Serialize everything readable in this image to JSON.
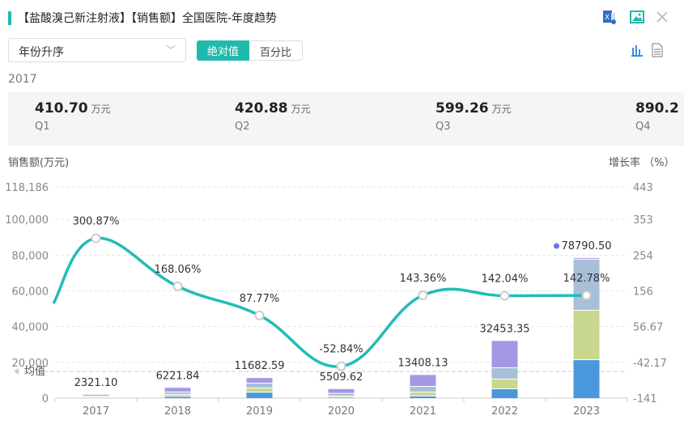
{
  "header": {
    "title": "【盐酸溴己新注射液】【销售额】全国医院-年度趋势",
    "icons": [
      "excel-export-icon",
      "image-export-icon",
      "close-icon"
    ]
  },
  "controls": {
    "sort_select": "年份升序",
    "toggle": {
      "absolute": "绝对值",
      "percent": "百分比"
    },
    "view_icons": [
      "bar-chart-icon",
      "document-icon"
    ]
  },
  "quarter_panel": {
    "year": "2017",
    "unit": "万元",
    "items": [
      {
        "value": "410.70",
        "label": "Q1"
      },
      {
        "value": "420.88",
        "label": "Q2"
      },
      {
        "value": "599.26",
        "label": "Q3"
      },
      {
        "value": "890.2",
        "label": "Q4"
      }
    ]
  },
  "colors": {
    "line": "#21bdb6",
    "q1": "#4a97dc",
    "q2": "#c8d88f",
    "q3": "#a7bfd9",
    "q4": "#a498e4",
    "total_dot": "#6d73e3"
  },
  "chart_data": {
    "type": "bar+line",
    "ylabel": "销售额(万元)",
    "y2label": "增长率 （%）",
    "categories": [
      "2017",
      "2018",
      "2019",
      "2020",
      "2021",
      "2022",
      "2023"
    ],
    "yticks": [
      "0",
      "20,000",
      "40,000",
      "60,000",
      "80,000",
      "100,000",
      "118,186"
    ],
    "ytick_values": [
      0,
      20000,
      40000,
      60000,
      80000,
      100000,
      118186
    ],
    "ylim": [
      0,
      118186
    ],
    "y2ticks": [
      "-141",
      "-42.17",
      "56.67",
      "156",
      "254",
      "353",
      "443"
    ],
    "y2tick_values": [
      -141,
      -42.17,
      56.67,
      156,
      254,
      353,
      443
    ],
    "y2lim": [
      -141,
      443
    ],
    "series": [
      {
        "name": "Q1",
        "values": [
          410.7,
          1200,
          3500,
          700,
          1400,
          5400,
          21700
        ]
      },
      {
        "name": "Q2",
        "values": [
          420.88,
          1100,
          2400,
          700,
          2200,
          5500,
          27700
        ]
      },
      {
        "name": "Q3",
        "values": [
          599.26,
          1400,
          2700,
          1500,
          3200,
          6300,
          28500
        ]
      },
      {
        "name": "Q4",
        "values": [
          890.26,
          2521.84,
          3082.59,
          2609.62,
          6608.13,
          15253.35,
          890.5
        ]
      }
    ],
    "totals": [
      "2321.10",
      "6221.84",
      "11682.59",
      "5509.62",
      "13408.13",
      "32453.35",
      "78790.50"
    ],
    "total_values": [
      2321.1,
      6221.84,
      11682.59,
      5509.62,
      13408.13,
      32453.35,
      78790.5
    ],
    "growth_labels": [
      "300.87%",
      "168.06%",
      "87.77%",
      "-52.84%",
      "143.36%",
      "142.04%",
      "142.78%"
    ],
    "growth": [
      300.87,
      168.06,
      87.77,
      -52.84,
      143.36,
      142.04,
      142.78
    ],
    "mean_label": "均值",
    "mean_value": 14950
  }
}
